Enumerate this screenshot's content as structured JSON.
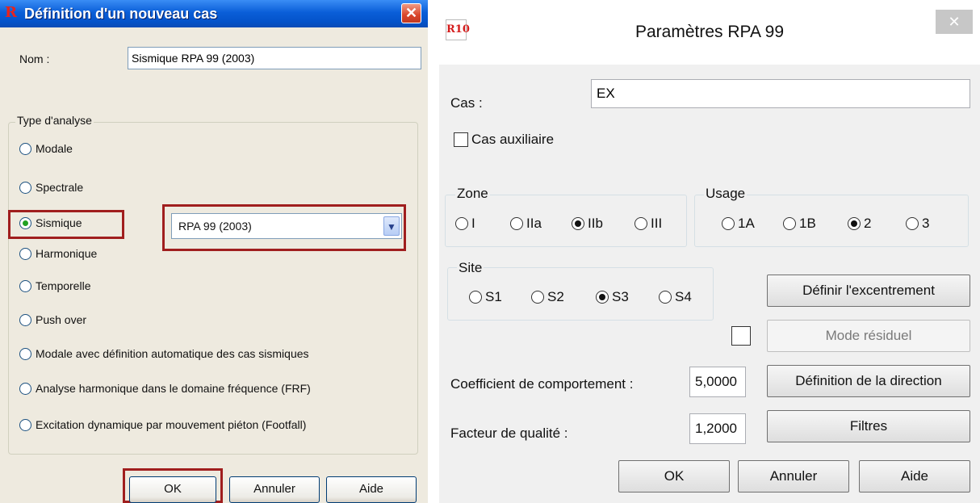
{
  "left_dialog": {
    "title": "Définition d'un nouveau cas",
    "app_icon": "R",
    "close_icon": "close-icon",
    "name_label": "Nom :",
    "name_value": "Sismique RPA 99 (2003)",
    "analysis_group": "Type d'analyse",
    "options": [
      "Modale",
      "Spectrale",
      "Sismique",
      "Harmonique",
      "Temporelle",
      "Push over",
      "Modale avec définition automatique des cas sismiques",
      "Analyse harmonique dans le domaine fréquence (FRF)",
      "Excitation dynamique par mouvement piéton (Footfall)"
    ],
    "selected_option": "Sismique",
    "code_select_value": "RPA 99 (2003)",
    "buttons": {
      "ok": "OK",
      "cancel": "Annuler",
      "help": "Aide"
    },
    "highlight_color": "#a01e1e"
  },
  "right_dialog": {
    "title": "Paramètres RPA 99",
    "app_icon": "R10",
    "close_icon": "close-icon",
    "case_label": "Cas :",
    "case_value": "EX",
    "auxiliary_label": "Cas auxiliaire",
    "auxiliary_checked": false,
    "zone": {
      "label": "Zone",
      "options": [
        "I",
        "IIa",
        "IIb",
        "III"
      ],
      "selected": "IIb"
    },
    "usage": {
      "label": "Usage",
      "options": [
        "1A",
        "1B",
        "2",
        "3"
      ],
      "selected": "2"
    },
    "site": {
      "label": "Site",
      "options": [
        "S1",
        "S2",
        "S3",
        "S4"
      ],
      "selected": "S3"
    },
    "eccentricity_button": "Définir l'excentrement",
    "residual_mode_button": "Mode résiduel",
    "residual_mode_checked": false,
    "behavior_label": "Coefficient de comportement :",
    "behavior_value": "5,0000",
    "direction_button": "Définition de la direction",
    "quality_label": "Facteur de qualité :",
    "quality_value": "1,2000",
    "filters_button": "Filtres",
    "buttons": {
      "ok": "OK",
      "cancel": "Annuler",
      "help": "Aide"
    }
  }
}
